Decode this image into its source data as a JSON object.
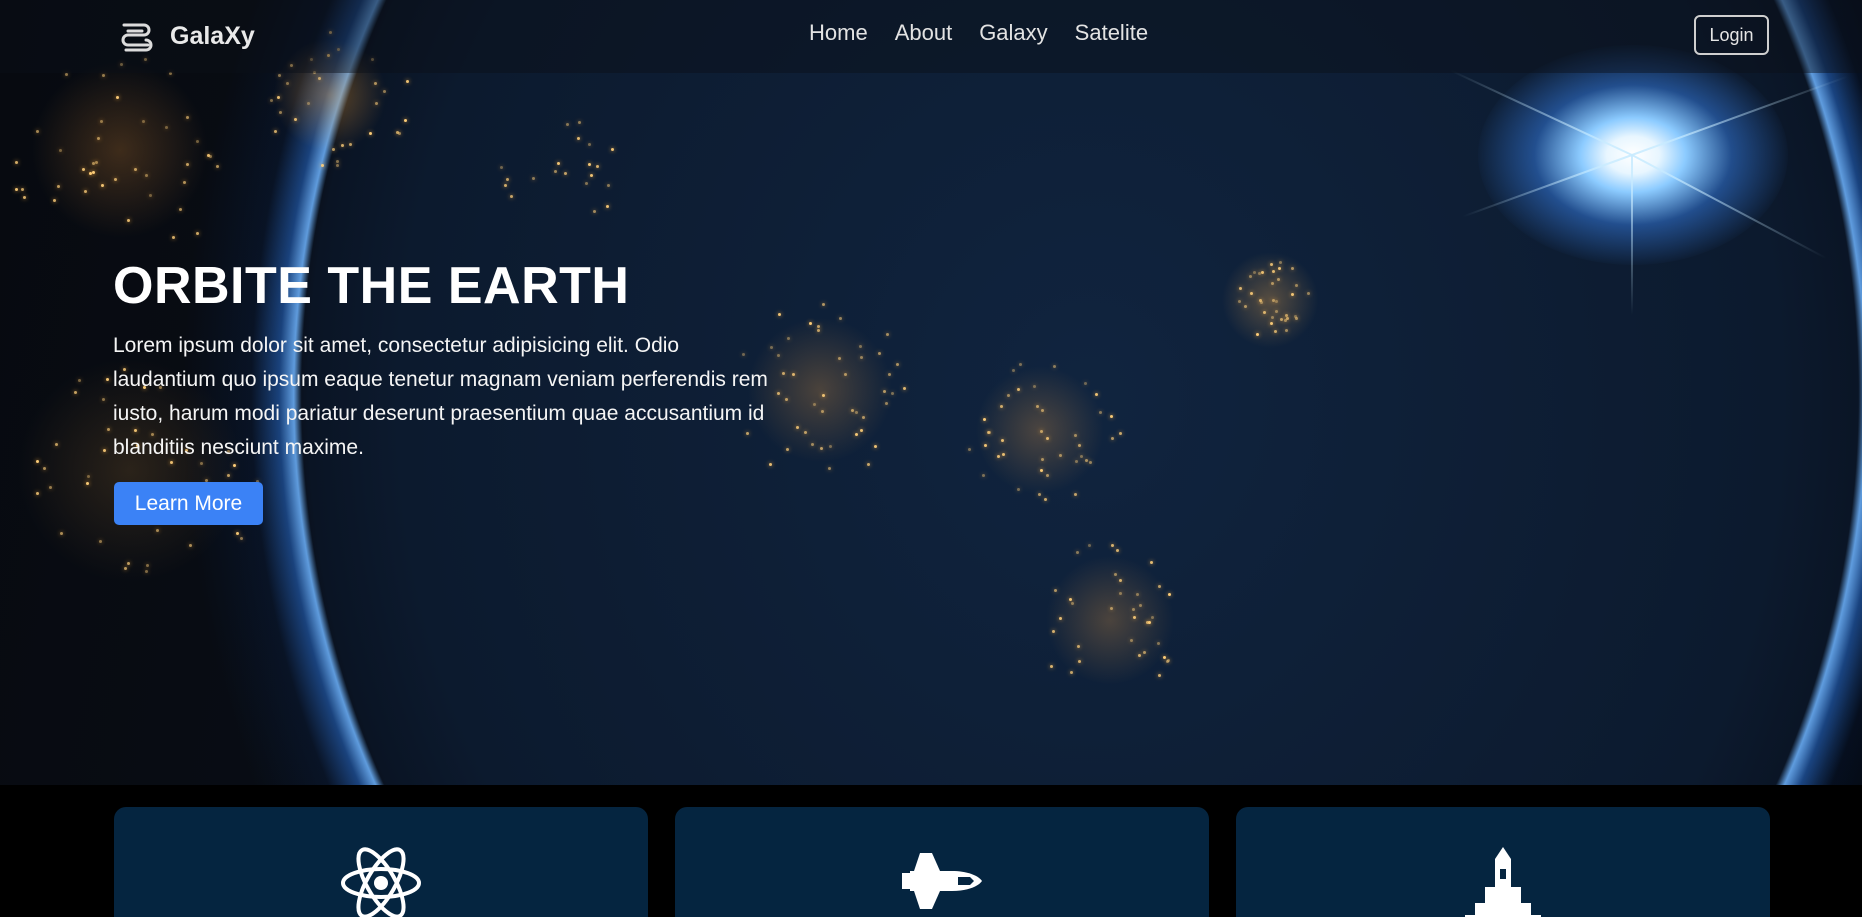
{
  "navbar": {
    "brand": "GalaXy",
    "links": [
      "Home",
      "About",
      "Galaxy",
      "Satelite"
    ],
    "login_label": "Login"
  },
  "hero": {
    "title": "ORBITE THE EARTH",
    "text": "Lorem ipsum dolor sit amet, consectetur adipisicing elit. Odio laudantium quo ipsum eaque tenetur magnam veniam perferendis rem iusto, harum modi pariatur deserunt praesentium quae accusantium id blanditiis nesciunt maxime.",
    "button_label": "Learn More"
  },
  "cards": [
    {
      "icon": "atom-icon"
    },
    {
      "icon": "space-shuttle-icon"
    },
    {
      "icon": "rocket-icon"
    }
  ],
  "colors": {
    "accent": "#3b82f6",
    "card_bg": "#052540",
    "nav_text": "#e3e3e3"
  }
}
